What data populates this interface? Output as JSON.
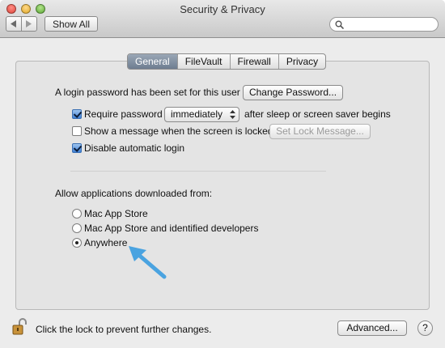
{
  "window": {
    "title": "Security & Privacy"
  },
  "toolbar": {
    "show_all_label": "Show All",
    "search_placeholder": "",
    "search_value": ""
  },
  "tabs": [
    {
      "label": "General",
      "selected": true
    },
    {
      "label": "FileVault",
      "selected": false
    },
    {
      "label": "Firewall",
      "selected": false
    },
    {
      "label": "Privacy",
      "selected": false
    }
  ],
  "general": {
    "login_text": "A login password has been set for this user",
    "change_password_label": "Change Password...",
    "require_password_label": "Require password",
    "require_password_checked": true,
    "require_password_delay": "immediately",
    "after_sleep_text": "after sleep or screen saver begins",
    "show_message_label": "Show a message when the screen is locked",
    "show_message_checked": false,
    "set_lock_message_label": "Set Lock Message...",
    "disable_auto_login_label": "Disable automatic login",
    "disable_auto_login_checked": true
  },
  "downloads": {
    "heading": "Allow applications downloaded from:",
    "options": [
      {
        "label": "Mac App Store",
        "selected": false
      },
      {
        "label": "Mac App Store and identified developers",
        "selected": false
      },
      {
        "label": "Anywhere",
        "selected": true
      }
    ]
  },
  "footer": {
    "lock_text": "Click the lock to prevent further changes.",
    "advanced_label": "Advanced...",
    "help_label": "?"
  },
  "colors": {
    "annotation_arrow": "#4aa3e0",
    "selected_tab": "#6e7d90"
  }
}
